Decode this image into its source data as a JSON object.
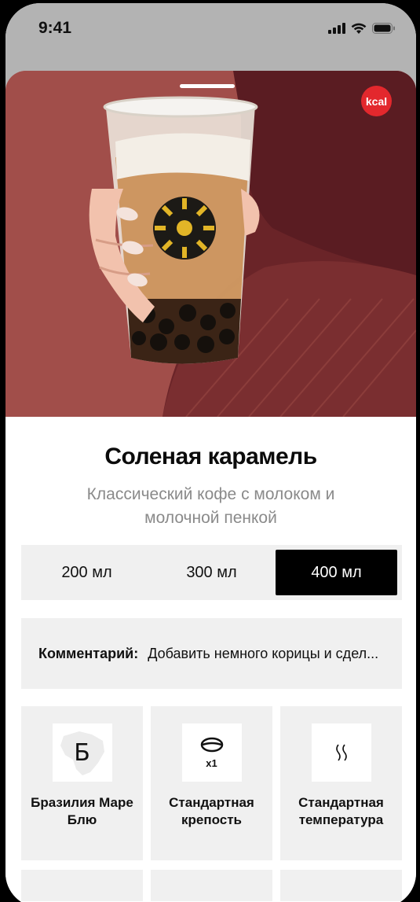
{
  "status_bar": {
    "time": "9:41"
  },
  "hero": {
    "kcal_badge": "kcal"
  },
  "product": {
    "title": "Соленая карамель",
    "subtitle": "Классический кофе с молоком и молочной пенкой"
  },
  "sizes": {
    "options": [
      "200 мл",
      "300 мл",
      "400 мл"
    ],
    "selected": "400 мл"
  },
  "comment": {
    "label": "Комментарий:",
    "value": "Добавить немного корицы и сдел..."
  },
  "options": [
    {
      "icon": "brazil-map-icon",
      "icon_text": "Б",
      "label": "Бразилия Маре Блю"
    },
    {
      "icon": "coffee-bean-icon",
      "icon_text": "x1",
      "label": "Стандартная крепость"
    },
    {
      "icon": "steam-icon",
      "label": "Стандартная температура"
    }
  ],
  "colors": {
    "accent": "#000000",
    "kcal_badge": "#e3282d",
    "card_bg": "#f0f0f0",
    "subtitle": "#8a8a8a"
  }
}
